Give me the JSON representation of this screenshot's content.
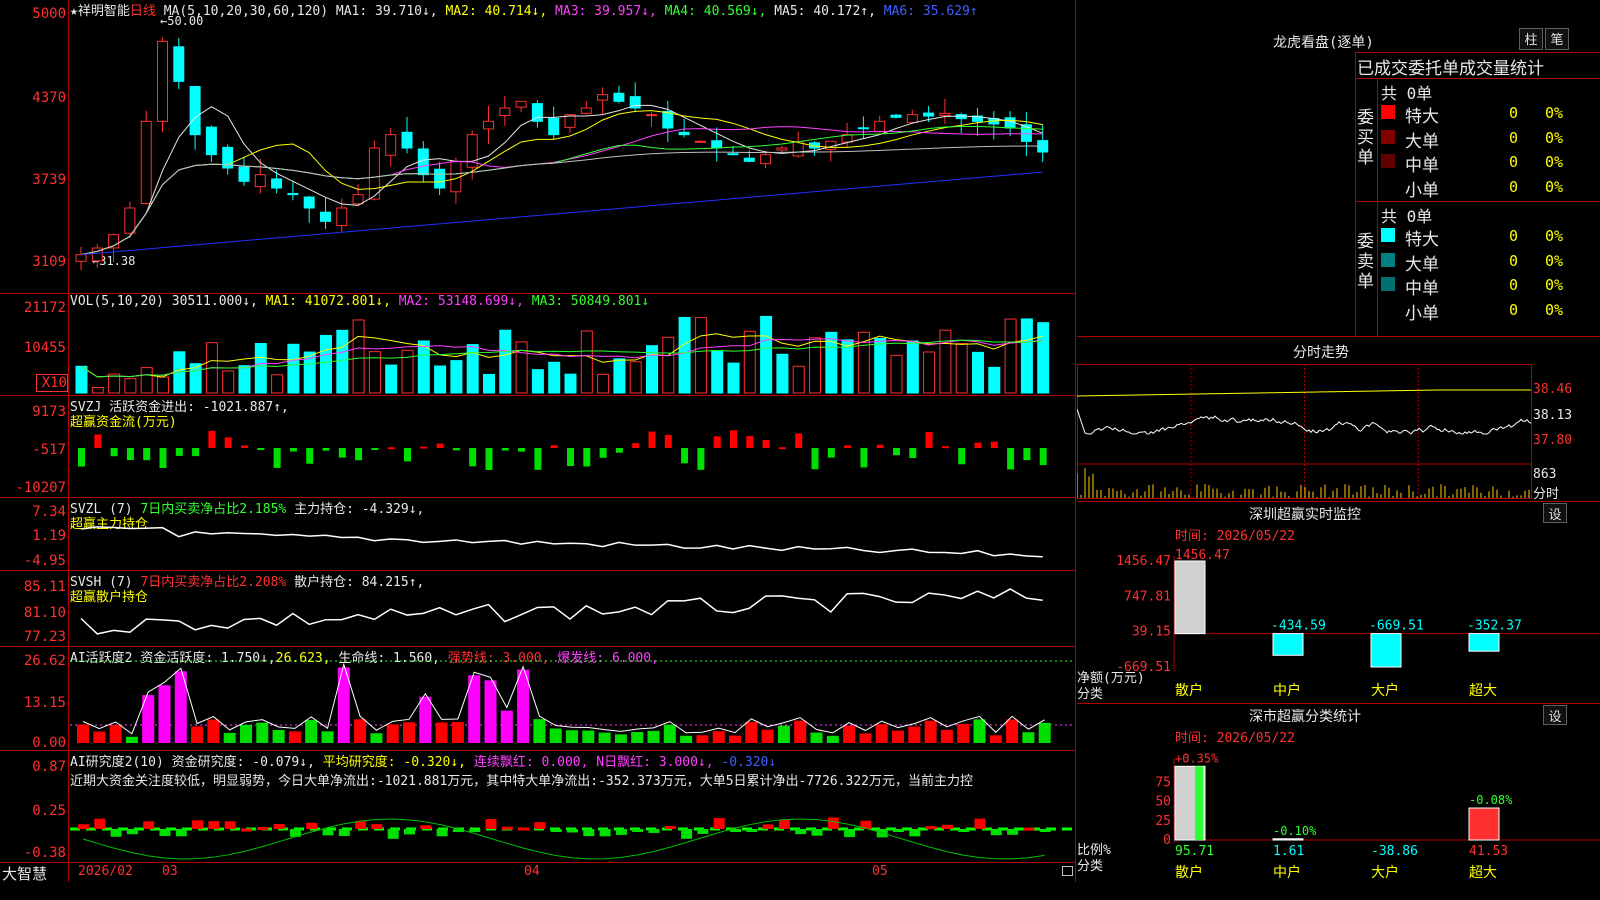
{
  "kline": {
    "stock_name": "祥明智能",
    "period": "日线",
    "ma_params": "MA(5,10,20,30,60,120)",
    "ma1": "MA1: 39.710↓,",
    "ma2": "MA2: 40.714↓,",
    "ma3": "MA3: 39.957↓,",
    "ma4": "MA4: 40.569↓,",
    "ma5": "MA5: 40.172↑,",
    "ma6": "MA6: 35.629↑",
    "high_label": "50.00",
    "low_label": "31.38",
    "y_ticks": [
      "5000",
      "4370",
      "3739",
      "3109"
    ]
  },
  "vol": {
    "params": "VOL(5,10,20)",
    "value": "30511.000↓,",
    "ma1": "MA1: 41072.801↓,",
    "ma2": "MA2: 53148.699↓,",
    "ma3": "MA3: 50849.801↓",
    "y_ticks": [
      "21172",
      "10455",
      "X10"
    ]
  },
  "svzj": {
    "title": "SVZJ  活跃资金进出: -1021.887↑,",
    "subtitle": "超赢资金流(万元)",
    "y_ticks": [
      "9173",
      "-517",
      "-10207"
    ]
  },
  "svzl": {
    "title_a": "SVZL (7)",
    "title_b": "7日内买卖净占比2.185%",
    "title_c": "主力持仓: -4.329↓,",
    "subtitle": "超赢主力持仓",
    "y_ticks": [
      "7.34",
      "1.19",
      "-4.95"
    ]
  },
  "svsh": {
    "title_a": "SVSH (7)",
    "title_b": "7日内买卖净占比2.208%",
    "title_c": "散户持仓: 84.215↑,",
    "subtitle": "超赢散户持仓",
    "y_ticks": [
      "85.11",
      "81.10",
      "77.23"
    ]
  },
  "ai_active": {
    "title_a": "AI活跃度2",
    "title_b": "资金活跃度: 1.750↓,",
    "title_c": "26.623,",
    "title_d": "生命线: 1.560,",
    "title_e": "强势线: 3.000,",
    "title_f": "爆发线: 6.000,",
    "y_ticks": [
      "26.62",
      "13.15",
      "0.00"
    ]
  },
  "ai_research": {
    "title_a": "AI研究度2(10)",
    "title_b": "资金研究度: -0.079↓,",
    "title_c": "平均研究度: -0.320↓,",
    "title_d": "连续飘红: 0.000,",
    "title_e": "N日飘红: 3.000↓,",
    "title_f": "-0.320↓",
    "comment": "近期大资金关注度较低，明显弱势，今日大单净流出:-1021.881万元，其中特大单净流出:-352.373万元，大单5日累计净出-7726.322万元，当前主力控",
    "y_ticks": [
      "0.87",
      "0.25",
      "-0.38"
    ]
  },
  "bottom": {
    "brand": "大智慧",
    "dates": [
      "2026/02",
      "03",
      "04",
      "05"
    ]
  },
  "dragon": {
    "title": "龙虎看盘(逐单)",
    "btn1": "柱",
    "btn2": "笔",
    "header": "已成交委托单成交量统计",
    "buy_label": "委买单",
    "sell_label": "委卖单",
    "buy_total": "共 0单",
    "sell_total": "共 0单",
    "buy_rows": [
      {
        "name": "特大",
        "count": "0",
        "pct": "0%",
        "color": "#ff0000"
      },
      {
        "name": "大单",
        "count": "0",
        "pct": "0%",
        "color": "#800000"
      },
      {
        "name": "中单",
        "count": "0",
        "pct": "0%",
        "color": "#600000"
      },
      {
        "name": "小单",
        "count": "0",
        "pct": "0%",
        "color": "#000000"
      }
    ],
    "sell_rows": [
      {
        "name": "特大",
        "count": "0",
        "pct": "0%",
        "color": "#00ffff"
      },
      {
        "name": "大单",
        "count": "0",
        "pct": "0%",
        "color": "#008080"
      },
      {
        "name": "中单",
        "count": "0",
        "pct": "0%",
        "color": "#007070"
      },
      {
        "name": "小单",
        "count": "0",
        "pct": "0%",
        "color": "#000000"
      }
    ]
  },
  "intraday": {
    "title": "分时走势",
    "y_ticks": [
      "38.46",
      "38.13",
      "37.80"
    ],
    "vol_top": "863",
    "vol_label": "分时"
  },
  "sz_monitor": {
    "title": "深圳超赢实时监控",
    "btn": "设",
    "time": "时间: 2026/05/22",
    "y_ticks": [
      "1456.47",
      "747.81",
      "39.15",
      "-669.51"
    ],
    "unit": "净额(万元)",
    "cat": "分类",
    "chart_data": {
      "type": "bar",
      "categories": [
        "散户",
        "中户",
        "大户",
        "超大"
      ],
      "values": [
        1456.47,
        -434.59,
        -669.51,
        -352.37
      ],
      "value_labels": [
        "1456.47",
        "-434.59",
        "-669.51",
        "-352.37"
      ],
      "ylim": [
        -669.51,
        1456.47
      ]
    }
  },
  "sz_class": {
    "title": "深市超赢分类统计",
    "btn": "设",
    "time": "时间: 2026/05/22",
    "y_ticks": [
      "75",
      "50",
      "25",
      "0"
    ],
    "unit": "比例%",
    "cat": "分类",
    "chart_data": {
      "type": "bar",
      "categories": [
        "散户",
        "中户",
        "大户",
        "超大"
      ],
      "values": [
        95.71,
        1.61,
        -38.86,
        41.53
      ],
      "value_labels": [
        "95.71",
        "1.61",
        "-38.86",
        "41.53"
      ],
      "change_labels": [
        "+0.35%",
        "-0.10%",
        "",
        "-0.08%"
      ],
      "ylim": [
        0,
        100
      ]
    }
  }
}
